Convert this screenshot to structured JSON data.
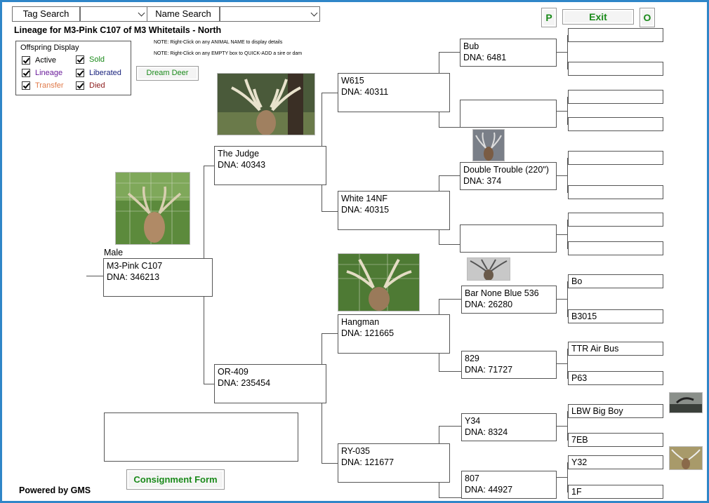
{
  "top": {
    "tag_search_label": "Tag Search",
    "tag_search_value": "",
    "name_search_label": "Name Search",
    "name_search_value": "",
    "p_label": "P",
    "exit_label": "Exit",
    "o_label": "O"
  },
  "page": {
    "title": "Lineage for M3-Pink C107 of M3 Whitetails - North",
    "note1": "NOTE: Right-Click on any ANIMAL NAME to display details",
    "note2": "NOTE: Right-Click on any EMPTY box to QUICK-ADD a sire or dam",
    "dream_deer": "Dream Deer",
    "consignment": "Consignment Form",
    "powered": "Powered by GMS"
  },
  "offspring": {
    "title": "Offspring Display",
    "options": [
      {
        "label": "Active",
        "color": "#000000",
        "checked": true
      },
      {
        "label": "Sold",
        "color": "#1a8a1a",
        "checked": true
      },
      {
        "label": "Lineage",
        "color": "#6a1b9a",
        "checked": true
      },
      {
        "label": "Liberated",
        "color": "#1a237e",
        "checked": true
      },
      {
        "label": "Transfer",
        "color": "#e07a4a",
        "checked": true
      },
      {
        "label": "Died",
        "color": "#8b1a1a",
        "checked": true
      }
    ]
  },
  "tree": {
    "root": {
      "sex": "Male",
      "name": "M3-Pink C107",
      "dna": "DNA: 346213"
    },
    "sire": {
      "name": "The Judge",
      "dna": "DNA: 40343"
    },
    "dam": {
      "name": "OR-409",
      "dna": "DNA: 235454"
    },
    "g2": [
      {
        "name": "W615",
        "dna": "DNA: 40311"
      },
      {
        "name": "White 14NF",
        "dna": "DNA: 40315"
      },
      {
        "name": "Hangman",
        "dna": "DNA: 121665"
      },
      {
        "name": "RY-035",
        "dna": "DNA: 121677"
      }
    ],
    "g3": [
      {
        "name": "Bub",
        "dna": "DNA: 6481"
      },
      {
        "name": "",
        "dna": ""
      },
      {
        "name": "Double Trouble (220\")",
        "dna": "DNA: 374"
      },
      {
        "name": "",
        "dna": ""
      },
      {
        "name": "Bar None Blue 536",
        "dna": "DNA: 26280"
      },
      {
        "name": "829",
        "dna": "DNA: 71727"
      },
      {
        "name": "Y34",
        "dna": "DNA: 8324"
      },
      {
        "name": "807",
        "dna": "DNA: 44927"
      }
    ],
    "g4": [
      "",
      "",
      "",
      "",
      "",
      "",
      "",
      "",
      "Bo",
      "B3015",
      "TTR Air Bus",
      "P63",
      "LBW Big Boy",
      "7EB",
      "Y32",
      "1F"
    ]
  }
}
